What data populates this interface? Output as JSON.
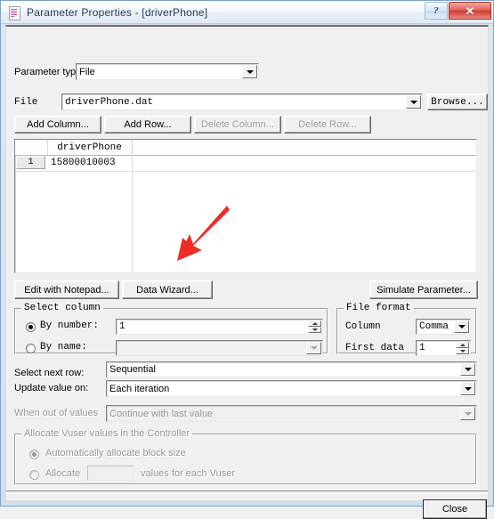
{
  "window": {
    "title": "Parameter Properties - [driverPhone]",
    "icon": "properties-document-icon",
    "help_button": "?",
    "close_button": "✕"
  },
  "parameter_type": {
    "label": "Parameter type:",
    "value": "File"
  },
  "file_row": {
    "label": "File",
    "value": "driverPhone.dat",
    "browse_label": "Browse..."
  },
  "table_buttons": {
    "add_column": "Add Column...",
    "add_row": "Add Row...",
    "delete_column": "Delete Column...",
    "delete_row": "Delete Row..."
  },
  "table": {
    "columns": [
      "driverPhone"
    ],
    "rows": [
      {
        "number": "1",
        "values": [
          "15800010003"
        ]
      }
    ]
  },
  "action_buttons": {
    "edit_with_notepad": "Edit with Notepad...",
    "data_wizard": "Data Wizard...",
    "simulate_parameter": "Simulate Parameter..."
  },
  "select_column": {
    "group_title": "Select column",
    "by_number_label": "By number:",
    "by_number_value": "1",
    "by_number_selected": true,
    "by_name_label": "By name:",
    "by_name_value": "",
    "by_name_selected": false
  },
  "file_format": {
    "group_title": "File format",
    "column_label": "Column",
    "column_value": "Comma",
    "first_data_label": "First data",
    "first_data_value": "1"
  },
  "row_settings": {
    "select_next_row_label": "Select next row:",
    "select_next_row_value": "Sequential",
    "update_value_on_label": "Update value on:",
    "update_value_on_value": "Each iteration",
    "when_out_of_values_label": "When out of values",
    "when_out_of_values_value": "Continue with last value"
  },
  "allocate": {
    "group_title": "Allocate Vuser values in the Controller",
    "auto_label": "Automatically allocate block size",
    "auto_selected": true,
    "allocate_label": "Allocate",
    "allocate_value": "",
    "allocate_suffix": "values for each Vuser",
    "allocate_selected": false
  },
  "footer": {
    "close_label": "Close"
  },
  "annotation": {
    "type": "red-arrow",
    "color": "#ef2d24",
    "points_to": "Data Wizard..."
  }
}
